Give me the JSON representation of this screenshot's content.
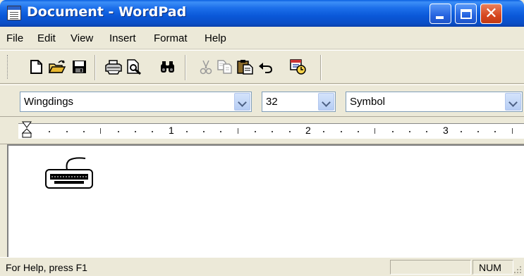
{
  "window": {
    "title": "Document - WordPad"
  },
  "menu": {
    "items": [
      {
        "label": "File"
      },
      {
        "label": "Edit"
      },
      {
        "label": "View"
      },
      {
        "label": "Insert"
      },
      {
        "label": "Format"
      },
      {
        "label": "Help"
      }
    ]
  },
  "toolbar": {
    "icons": [
      "new-document-icon",
      "open-folder-icon",
      "save-disk-icon",
      "print-icon",
      "print-preview-icon",
      "find-binoculars-icon",
      "cut-scissors-icon",
      "copy-icon",
      "paste-icon",
      "undo-icon",
      "insert-date-time-icon"
    ]
  },
  "format": {
    "font": "Wingdings",
    "size": "32",
    "script": "Symbol"
  },
  "ruler": {
    "numbers": [
      "1",
      "2",
      "3"
    ]
  },
  "document": {
    "content_icon": "keyboard-icon"
  },
  "status": {
    "help_text": "For Help, press F1",
    "num_indicator": "NUM"
  },
  "colors": {
    "titlebar": "#0A58D8",
    "close_button": "#d6461f",
    "chrome": "#ECE9D8"
  }
}
